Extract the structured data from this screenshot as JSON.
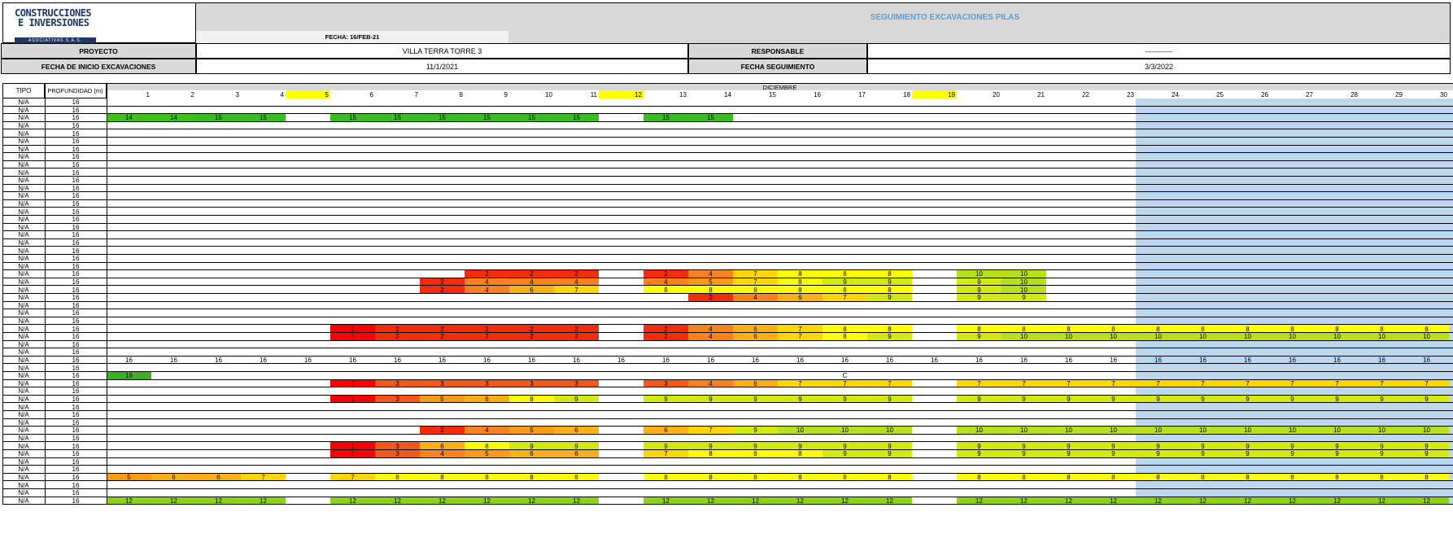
{
  "logo": {
    "line1": "CONSTRUCCIONES",
    "line2": "E INVERSIONES",
    "line3": "ASOCIATIVAS S.A.S."
  },
  "title": "SEGUIMIENTO EXCAVACIONES PILAS",
  "fecha": "FECHA: 16/FEB-21",
  "info": {
    "proyecto_label": "PROYECTO",
    "proyecto_value": "VILLA TERRA TORRE 3",
    "responsable_label": "RESPONSABLE",
    "responsable_value": "------------",
    "inicio_label": "FECHA DE INICIO EXCAVACIONES",
    "inicio_value": "11/1/2021",
    "seguimiento_label": "FECHA SEGUIMIENTO",
    "seguimiento_value": "3/3/2022"
  },
  "table": {
    "tipo_header": "TIPO",
    "prof_header": "PROFUNDIDAD (m)",
    "month": "DICIEMBRE",
    "days": [
      1,
      2,
      3,
      4,
      5,
      6,
      7,
      8,
      9,
      10,
      11,
      12,
      13,
      14,
      15,
      16,
      17,
      18,
      19,
      20,
      21,
      22,
      23,
      24,
      25,
      26,
      27,
      28,
      29,
      30
    ],
    "highlight_days": [
      5,
      12,
      19
    ],
    "shaded_from_day": 24,
    "row_tipo": "N/A",
    "row_prof": "16",
    "rows": [
      {},
      {},
      {
        "cells": {
          "1": 14,
          "2": 14,
          "3": 15,
          "4": 15,
          "6": 15,
          "7": 15,
          "8": 15,
          "9": 15,
          "10": 15,
          "11": 15,
          "13": 15,
          "14": 15
        }
      },
      {},
      {},
      {},
      {},
      {},
      {},
      {},
      {},
      {},
      {},
      {},
      {},
      {},
      {},
      {},
      {},
      {},
      {},
      {},
      {
        "cells": {
          "9": 2,
          "10": 2,
          "11": 2,
          "13": 2,
          "14": 4,
          "15": 7,
          "16": 8,
          "17": 8,
          "18": 8,
          "20": 10,
          "21": 10
        }
      },
      {
        "cells": {
          "8": 2,
          "9": 4,
          "10": 4,
          "11": 4,
          "13": 4,
          "14": 5,
          "15": 7,
          "16": 8,
          "17": 9,
          "18": 9,
          "20": 9,
          "21": 10
        }
      },
      {
        "cells": {
          "8": 2,
          "9": 4,
          "10": 6,
          "11": 7,
          "13": 8,
          "14": 8,
          "15": 8,
          "16": 8,
          "17": 8,
          "18": 8,
          "20": 9,
          "21": 10
        }
      },
      {
        "cells": {
          "14": 2,
          "15": 4,
          "16": 6,
          "17": 7,
          "18": 9,
          "20": 9,
          "21": 9
        }
      },
      {},
      {},
      {},
      {
        "cells": {
          "6": 1,
          "7": 2,
          "8": 2,
          "9": 2,
          "10": 2,
          "11": 2,
          "13": 2,
          "14": 4,
          "15": 6,
          "16": 7,
          "17": 8,
          "18": 8,
          "20": 8,
          "21": 8,
          "22": 8,
          "23": 8,
          "24": 8,
          "25": 8,
          "26": 8,
          "27": 8,
          "28": 8,
          "29": 8,
          "30": 8
        }
      },
      {
        "cells": {
          "6": 1,
          "7": 2,
          "8": 2,
          "9": 2,
          "10": 2,
          "11": 2,
          "13": 2,
          "14": 4,
          "15": 6,
          "16": 7,
          "17": 8,
          "18": 9,
          "20": 9,
          "21": 10,
          "22": 10,
          "23": 10,
          "24": 10,
          "25": 10,
          "26": 10,
          "27": 10,
          "28": 10,
          "29": 10,
          "30": 10
        }
      },
      {},
      {},
      {
        "plain": {
          "1": 16,
          "2": 16,
          "3": 16,
          "4": 16,
          "5": 16,
          "6": 16,
          "7": 16,
          "8": 16,
          "9": 16,
          "10": 16,
          "11": 16,
          "12": 16,
          "13": 16,
          "14": 16,
          "15": 16,
          "16": 16,
          "17": 16,
          "18": 16,
          "19": 16,
          "20": 16,
          "21": 16,
          "22": 16,
          "23": 16,
          "24": 16,
          "25": 16,
          "26": 16,
          "27": 16,
          "28": 16,
          "29": 16,
          "30": 16
        }
      },
      {},
      {
        "cells": {
          "1": 16
        },
        "plain": {
          "17": "C"
        }
      },
      {
        "cells": {
          "6": 1,
          "7": 3,
          "8": 3,
          "9": 3,
          "10": 3,
          "11": 3,
          "13": 3,
          "14": 4,
          "15": 6,
          "16": 7,
          "17": 7,
          "18": 7,
          "20": 7,
          "21": 7,
          "22": 7,
          "23": 7,
          "24": 7,
          "25": 7,
          "26": 7,
          "27": 7,
          "28": 7,
          "29": 7,
          "30": 7
        }
      },
      {},
      {
        "cells": {
          "6": 1,
          "7": 3,
          "8": 5,
          "9": 6,
          "10": 8,
          "11": 9,
          "13": 9,
          "14": 9,
          "15": 9,
          "16": 9,
          "17": 9,
          "18": 9,
          "20": 9,
          "21": 9,
          "22": 9,
          "23": 9,
          "24": 9,
          "25": 9,
          "26": 9,
          "27": 9,
          "28": 9,
          "29": 9,
          "30": 9
        }
      },
      {},
      {},
      {},
      {
        "cells": {
          "8": 2,
          "9": 4,
          "10": 5,
          "11": 6,
          "13": 6,
          "14": 7,
          "15": 9,
          "16": 10,
          "17": 10,
          "18": 10,
          "20": 10,
          "21": 10,
          "22": 10,
          "23": 10,
          "24": 10,
          "25": 10,
          "26": 10,
          "27": 10,
          "28": 10,
          "29": 10,
          "30": 10
        }
      },
      {},
      {
        "cells": {
          "6": 1,
          "7": 3,
          "8": 6,
          "9": 8,
          "10": 9,
          "11": 9,
          "13": 9,
          "14": 9,
          "15": 9,
          "16": 9,
          "17": 9,
          "18": 9,
          "20": 9,
          "21": 9,
          "22": 9,
          "23": 9,
          "24": 9,
          "25": 9,
          "26": 9,
          "27": 9,
          "28": 9,
          "29": 9,
          "30": 9
        }
      },
      {
        "cells": {
          "6": 1,
          "7": 3,
          "8": 4,
          "9": 5,
          "10": 6,
          "11": 6,
          "13": 7,
          "14": 8,
          "15": 8,
          "16": 8,
          "17": 9,
          "18": 9,
          "20": 9,
          "21": 9,
          "22": 9,
          "23": 9,
          "24": 9,
          "25": 9,
          "26": 9,
          "27": 9,
          "28": 9,
          "29": 9,
          "30": 9
        }
      },
      {},
      {},
      {
        "cells": {
          "1": 5,
          "2": 6,
          "3": 6,
          "4": 7,
          "6": 7,
          "7": 8,
          "8": 8,
          "9": 8,
          "10": 8,
          "11": 8,
          "13": 8,
          "14": 8,
          "15": 8,
          "16": 8,
          "17": 8,
          "18": 8,
          "20": 8,
          "21": 8,
          "22": 8,
          "23": 8,
          "24": 8,
          "25": 8,
          "26": 8,
          "27": 8,
          "28": 8,
          "29": 8,
          "30": 8
        }
      },
      {},
      {},
      {
        "cells": {
          "1": 12,
          "2": 12,
          "3": 12,
          "4": 12,
          "6": 12,
          "7": 12,
          "8": 12,
          "9": 12,
          "10": 12,
          "11": 12,
          "13": 12,
          "14": 12,
          "15": 12,
          "16": 12,
          "17": 12,
          "18": 12,
          "20": 12,
          "21": 12,
          "22": 12,
          "23": 12,
          "24": 12,
          "25": 12,
          "26": 12,
          "27": 12,
          "28": 12,
          "29": 12,
          "30": 12
        }
      }
    ]
  },
  "colors": {
    "header_gray": "#d9d9d9",
    "title_blue": "#5b9bd5",
    "day_highlight": "#ffff00",
    "shade_blue": "#bdd7ee",
    "scale": {
      "1": "#ff0000",
      "2": "#f22c0c",
      "3": "#f5561b",
      "4": "#f7821f",
      "5": "#f89c18",
      "6": "#fbb018",
      "7": "#ffd700",
      "8": "#ffff00",
      "9": "#d4e90f",
      "10": "#b8e01e",
      "12": "#8cd21c",
      "14": "#3fbf1a",
      "15": "#3cbc24",
      "16": "#39b224"
    }
  }
}
